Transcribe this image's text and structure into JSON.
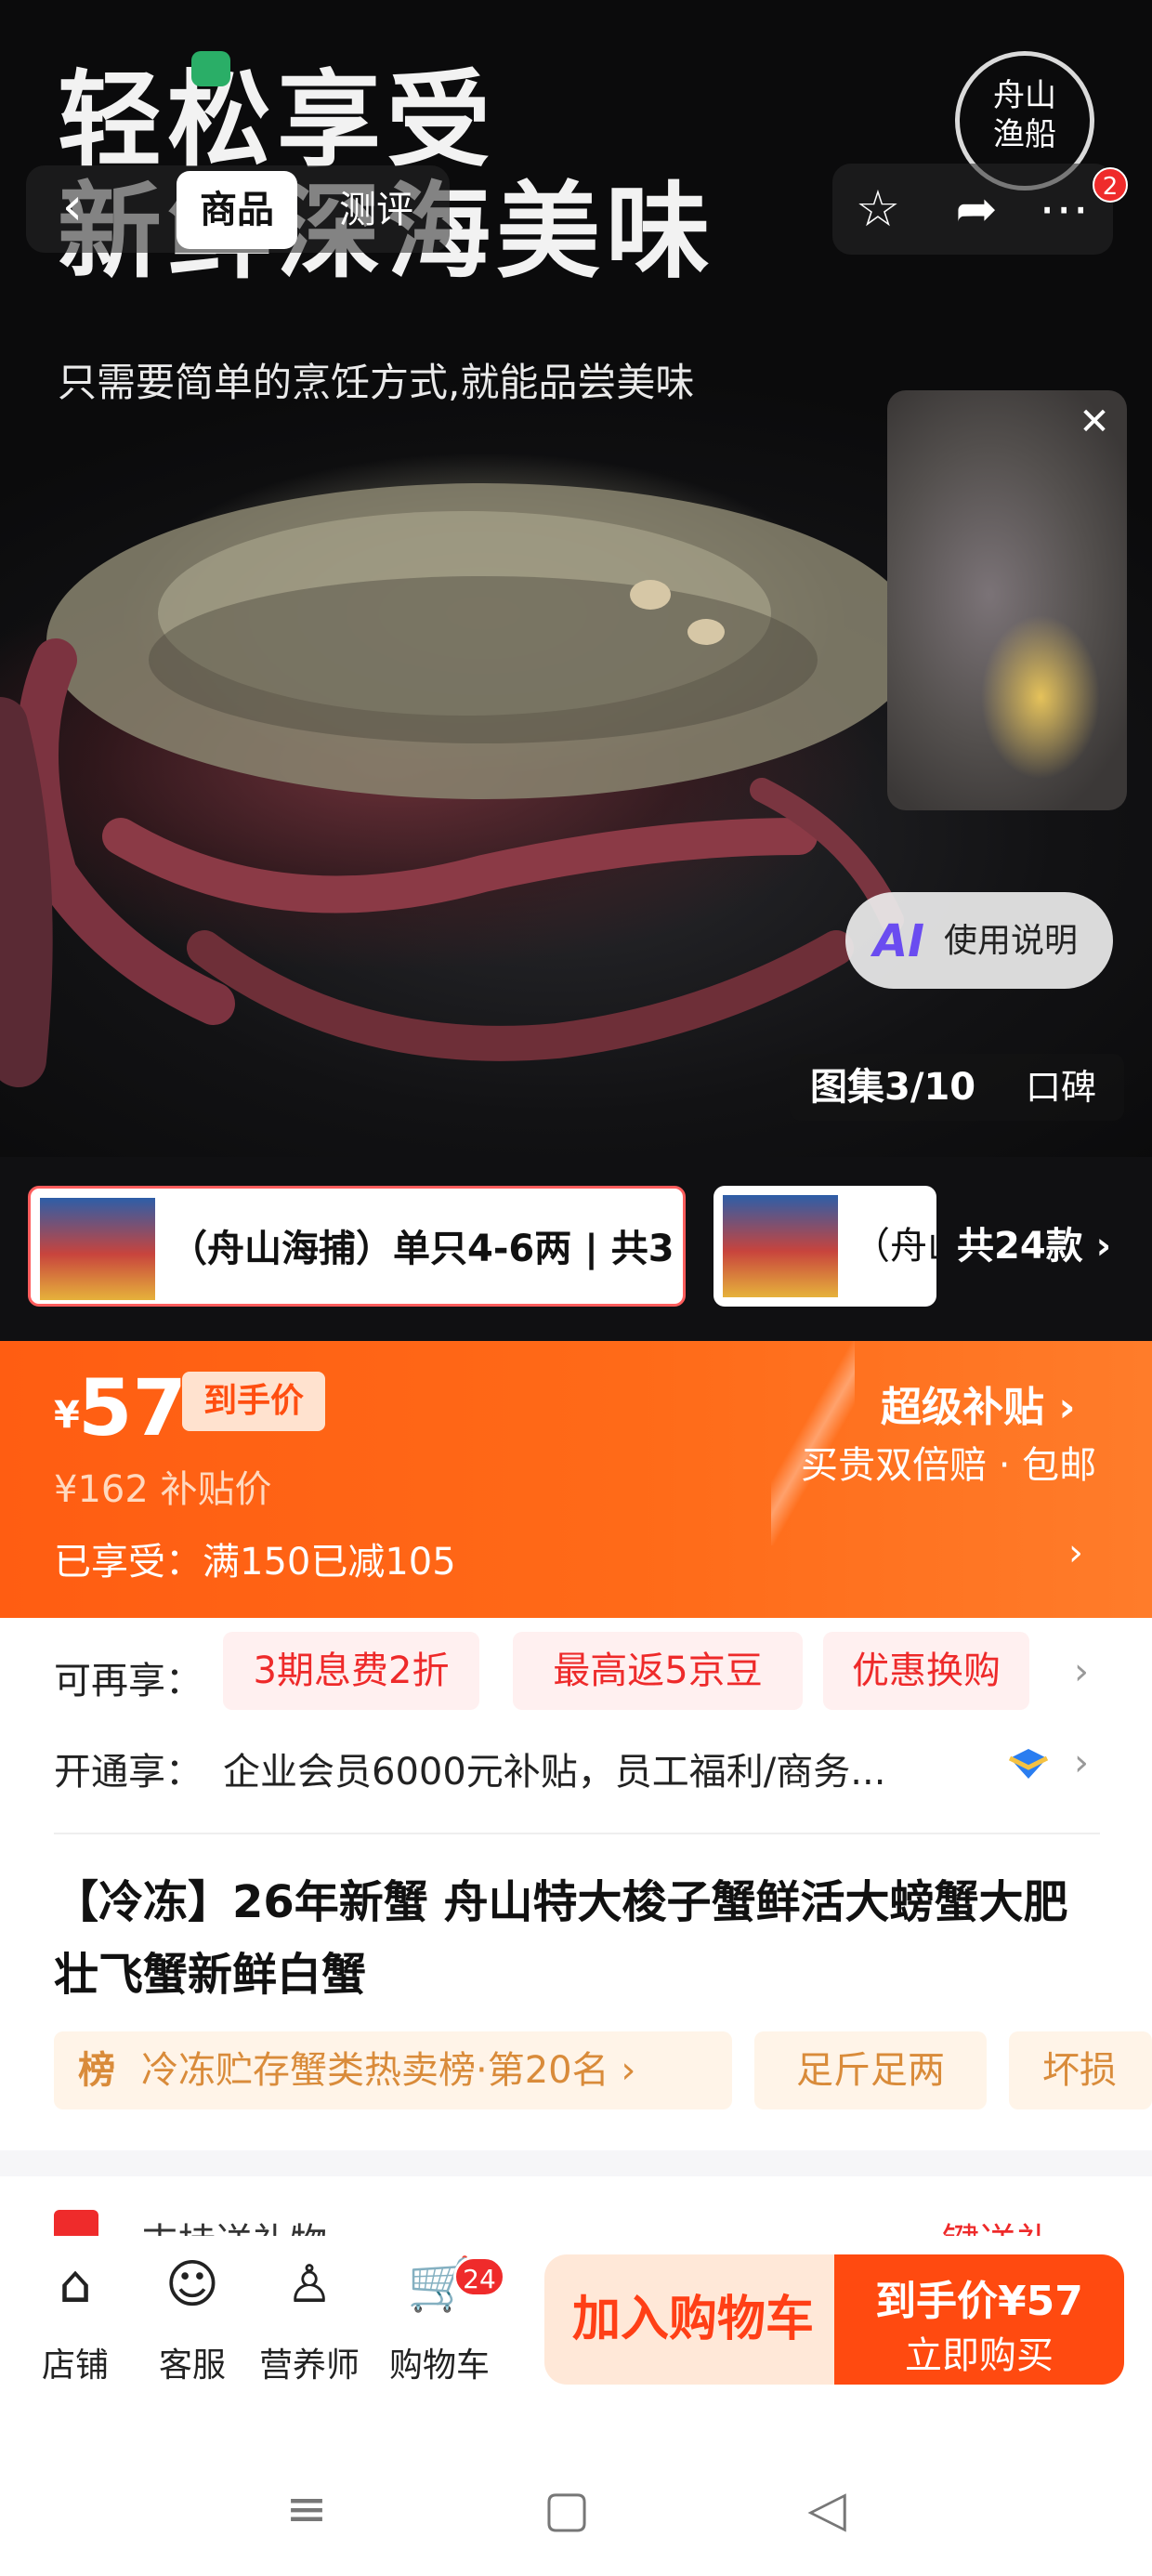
{
  "hero": {
    "headline_line1": "轻松享受",
    "headline_line2": "新鲜深海美味",
    "subline": "只需要简单的烹饪方式,就能品尝美味",
    "tabs": {
      "back_icon": "chevron-left-icon",
      "active": "商品",
      "review": "测评"
    },
    "actions": {
      "favorite_icon": "star-icon",
      "share_icon": "share-icon",
      "more_icon": "more-icon",
      "notification_count": "2"
    },
    "brand_logo_text": "舟山渔船",
    "ai_button": {
      "icon": "AI",
      "label": "使用说明"
    },
    "album": {
      "label": "图集3/10",
      "review_label": "口碑"
    }
  },
  "variants": {
    "items": [
      {
        "label": "（舟山海捕）单只4-6两 | 共3"
      },
      {
        "label": "（舟山"
      }
    ],
    "total_label": "共24款"
  },
  "price": {
    "currency": "¥",
    "final_price": "57",
    "final_tag": "到手价",
    "subsidy_price": "¥162",
    "subsidy_label": "补贴价",
    "enjoyed": "已享受：满150已减105",
    "super_subsidy": "超级补贴",
    "super_desc": "买贵双倍赔 · 包邮",
    "accent": "#ff5d12"
  },
  "benefits": {
    "extra_label": "可再享：",
    "extra_chips": [
      "3期息费2折",
      "最高返5京豆",
      "优惠换购"
    ],
    "vip_label": "开通享：",
    "vip_text": "企业会员6000元补贴，员工福利/商务..."
  },
  "product": {
    "title": "【冷冻】26年新蟹 舟山特大梭子蟹鲜活大螃蟹大肥壮飞蟹新鲜白蟹",
    "rank_icon": "榜",
    "rank_text": "冷冻贮存蟹类热卖榜·第20名",
    "tags": [
      "足斤足两",
      "坏损包"
    ]
  },
  "gift": {
    "label": "支持送礼物",
    "cta": "一键送礼"
  },
  "bottom_bar": {
    "nav": [
      {
        "label": "店铺",
        "icon": "store-icon"
      },
      {
        "label": "客服",
        "icon": "customer-service-icon"
      },
      {
        "label": "营养师",
        "icon": "nutritionist-icon"
      },
      {
        "label": "购物车",
        "icon": "cart-icon"
      }
    ],
    "cart_count": "24",
    "add_to_cart": "加入购物车",
    "buy_price": "到手价¥57",
    "buy_now": "立即购买"
  }
}
